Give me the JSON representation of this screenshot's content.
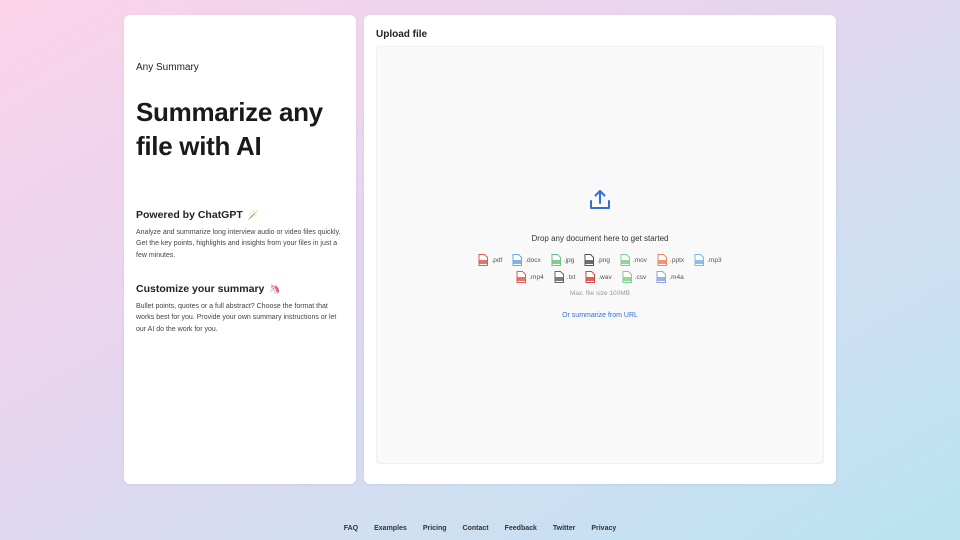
{
  "left": {
    "brand": "Any Summary",
    "hero": "Summarize any file with AI",
    "sections": [
      {
        "title": "Powered by ChatGPT",
        "emoji": "🪄",
        "text": "Analyze and summarize long interview audio or video files quickly. Get the key points, highlights and insights from your files in just a few minutes."
      },
      {
        "title": "Customize your summary",
        "emoji": "🦄",
        "text": "Bullet points, quotes or a full abstract? Choose the format that works best for you. Provide your own summary instructions or let our AI do the work for you."
      }
    ]
  },
  "upload": {
    "title": "Upload file",
    "drop_text": "Drop any document here to get started",
    "formats_row1": [
      {
        "ext": ".pdf",
        "icon": "pdf-file-icon",
        "color": "#e25b4e"
      },
      {
        "ext": ".docx",
        "icon": "docx-file-icon",
        "color": "#6aa6e8"
      },
      {
        "ext": ".jpg",
        "icon": "jpg-file-icon",
        "color": "#6cc37f"
      },
      {
        "ext": ".png",
        "icon": "png-file-icon",
        "color": "#555555"
      },
      {
        "ext": ".mov",
        "icon": "mov-file-icon",
        "color": "#7fcf8a"
      },
      {
        "ext": ".pptx",
        "icon": "pptx-file-icon",
        "color": "#f0845a"
      },
      {
        "ext": ".mp3",
        "icon": "mp3-file-icon",
        "color": "#7ab6e6"
      }
    ],
    "formats_row2": [
      {
        "ext": ".mp4",
        "icon": "mp4-file-icon",
        "color": "#e25b4e"
      },
      {
        "ext": ".txt",
        "icon": "txt-file-icon",
        "color": "#666666"
      },
      {
        "ext": ".wav",
        "icon": "wav-file-icon",
        "color": "#d9443b"
      },
      {
        "ext": ".csv",
        "icon": "csv-file-icon",
        "color": "#7fcf8a"
      },
      {
        "ext": ".m4a",
        "icon": "m4a-file-icon",
        "color": "#8aa6e6"
      }
    ],
    "max_size": "Max. file size 100MB",
    "url_link": "Or summarize from URL",
    "accent": "#2f6fd6"
  },
  "footer": {
    "links": [
      "FAQ",
      "Examples",
      "Pricing",
      "Contact",
      "Feedback",
      "Twitter",
      "Privacy"
    ]
  }
}
